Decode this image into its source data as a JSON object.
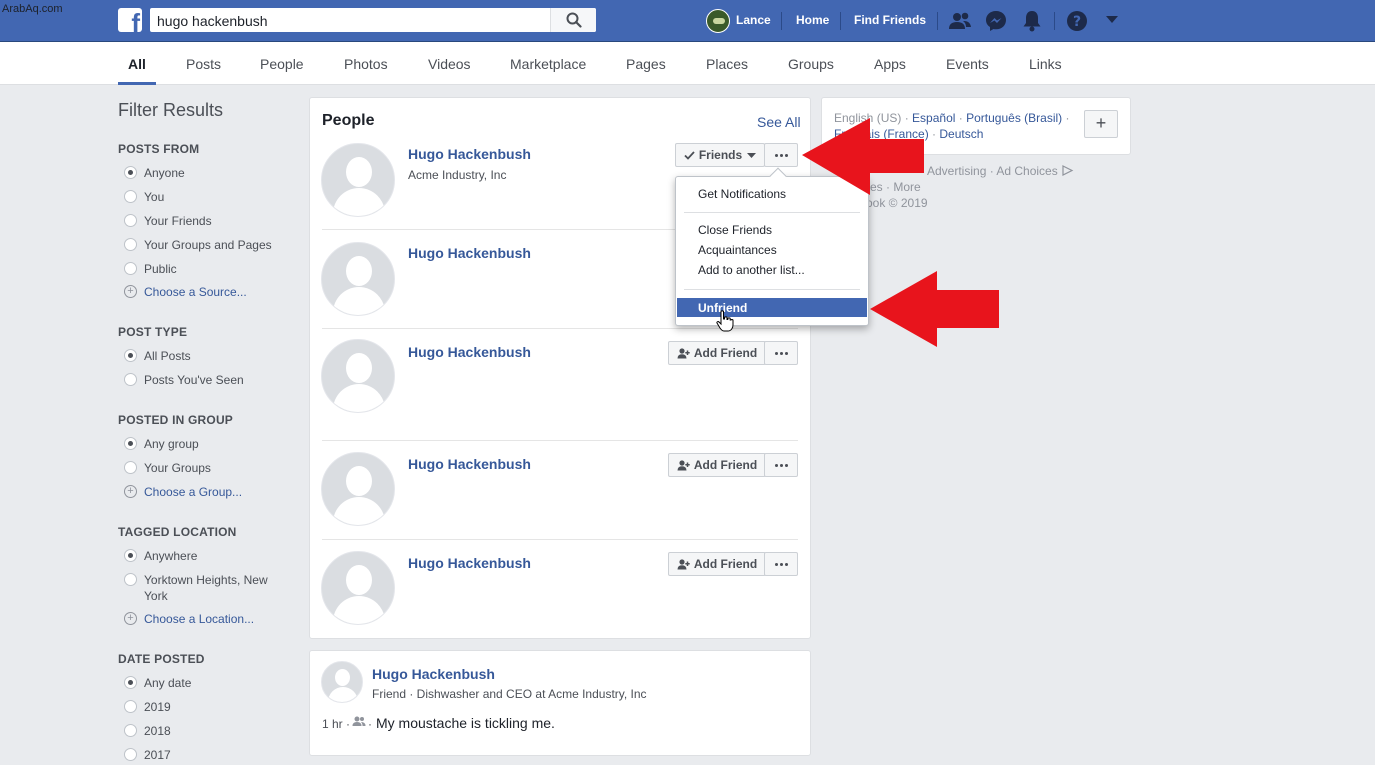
{
  "watermark": "ArabAq.com",
  "header": {
    "search_value": "hugo hackenbush",
    "user_name": "Lance",
    "home": "Home",
    "find_friends": "Find Friends"
  },
  "tabs": [
    "All",
    "Posts",
    "People",
    "Photos",
    "Videos",
    "Marketplace",
    "Pages",
    "Places",
    "Groups",
    "Apps",
    "Events",
    "Links"
  ],
  "filters": {
    "title": "Filter Results",
    "posts_from": {
      "heading": "POSTS FROM",
      "options": [
        "Anyone",
        "You",
        "Your Friends",
        "Your Groups and Pages",
        "Public"
      ],
      "link": "Choose a Source..."
    },
    "post_type": {
      "heading": "POST TYPE",
      "options": [
        "All Posts",
        "Posts You've Seen"
      ]
    },
    "posted_in_group": {
      "heading": "POSTED IN GROUP",
      "options": [
        "Any group",
        "Your Groups"
      ],
      "link": "Choose a Group..."
    },
    "tagged_location": {
      "heading": "TAGGED LOCATION",
      "options": [
        "Anywhere",
        "Yorktown Heights, New",
        "York"
      ],
      "link": "Choose a Location..."
    },
    "date_posted": {
      "heading": "DATE POSTED",
      "options": [
        "Any date",
        "2019",
        "2018",
        "2017"
      ]
    }
  },
  "people": {
    "title": "People",
    "see_all": "See All",
    "results": [
      {
        "name": "Hugo Hackenbush",
        "subtitle": "Acme Industry, Inc",
        "action": "Friends"
      },
      {
        "name": "Hugo Hackenbush",
        "subtitle": "",
        "action": ""
      },
      {
        "name": "Hugo Hackenbush",
        "subtitle": "",
        "action": "Add Friend"
      },
      {
        "name": "Hugo Hackenbush",
        "subtitle": "",
        "action": "Add Friend"
      },
      {
        "name": "Hugo Hackenbush",
        "subtitle": "",
        "action": "Add Friend"
      }
    ]
  },
  "friend_menu": {
    "items": [
      "Get Notifications",
      "Close Friends",
      "Acquaintances",
      "Add to another list...",
      "Unfriend"
    ]
  },
  "post": {
    "author": "Hugo Hackenbush",
    "meta": "Friend · Dishwasher and CEO at Acme Industry, Inc",
    "time": "1 hr ·",
    "audience_suffix": "·",
    "text": "My moustache is tickling me."
  },
  "right": {
    "languages": [
      "English (US)",
      "Español",
      "Português (Brasil)",
      "Français (France)",
      "Deutsch"
    ],
    "lang_sep": "·",
    "footer_line1_visible": "Advertising · Ad Choices",
    "footer_line2_visible": "es · More",
    "footer_line3_visible": "ook © 2019"
  },
  "colors": {
    "brand": "#4267b2",
    "link": "#365899",
    "highlight": "#4267b2",
    "annotation_arrow": "#e8141c"
  }
}
